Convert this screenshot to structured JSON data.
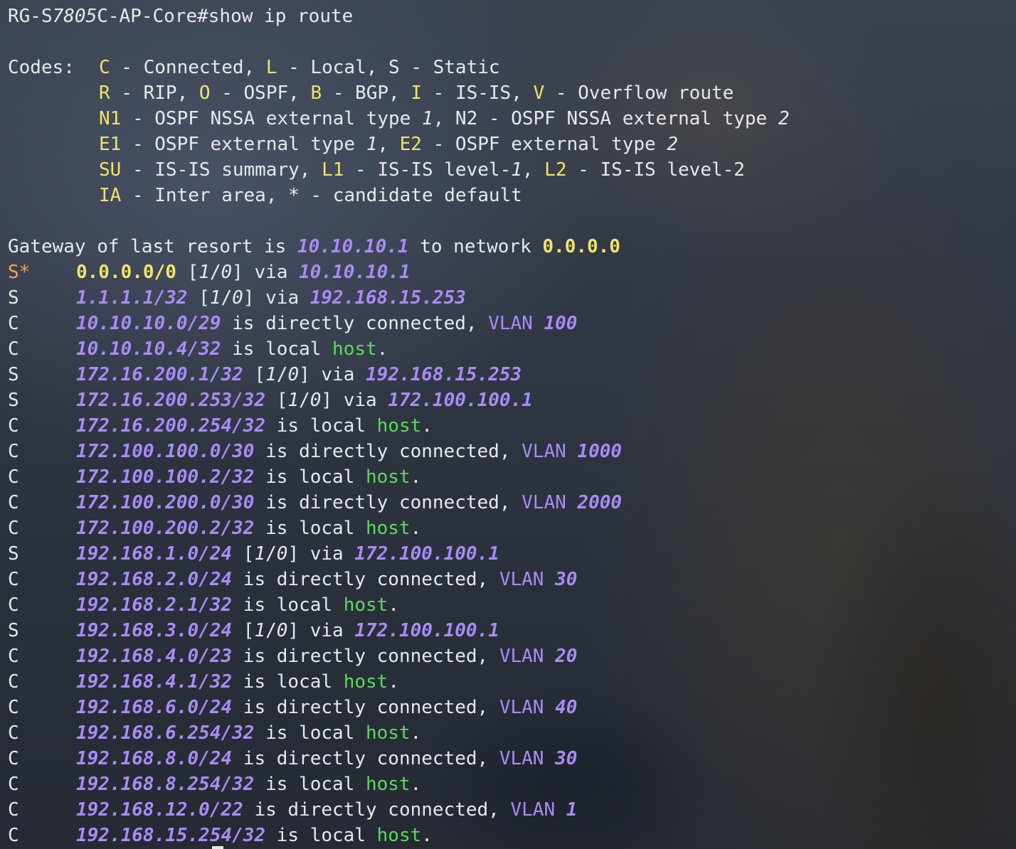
{
  "terminal": {
    "prompt_host": "RG-S",
    "prompt_model": "7805",
    "prompt_rest": "C-AP-Core#show ip route"
  },
  "codes": {
    "label": "Codes:",
    "line1": {
      "c": "C",
      "c_txt": " - Connected, ",
      "l": "L",
      "l_txt": " - Local, S - Static"
    },
    "line2": {
      "r": "R",
      "r_txt": " - RIP, ",
      "o": "O",
      "o_txt": " - OSPF, ",
      "b": "B",
      "b_txt": " - BGP, ",
      "i": "I",
      "i_txt": " - IS-IS, ",
      "v": "V",
      "v_txt": " - Overflow route"
    },
    "line3": {
      "n1": "N1",
      "n1_txt": " - OSPF NSSA external type ",
      "n1_num": "1",
      "n2_txt": ", N2 - OSPF NSSA external type ",
      "n2_num": "2"
    },
    "line4": {
      "e1": "E1",
      "e1_txt": " - OSPF external type ",
      "e1_num": "1",
      "sep": ", ",
      "e2": "E2",
      "e2_txt": " - OSPF external type ",
      "e2_num": "2"
    },
    "line5": {
      "su": "SU",
      "su_txt": " - IS-IS summary, ",
      "l1": "L1",
      "l1_txt": " - IS-IS level-",
      "l1_num": "1",
      "sep": ", ",
      "l2": "L2",
      "l2_txt": " - IS-IS level-2"
    },
    "line6": {
      "ia": "IA",
      "ia_txt": " - Inter area, * - candidate default"
    }
  },
  "gateway": {
    "prefix": "Gateway of last resort is ",
    "ip": "10.10.10.1",
    "mid": " to network ",
    "network": "0.0.0.0"
  },
  "default_route": {
    "flag": "S*",
    "network": "0.0.0.0/0",
    "metric_open": " [",
    "metric_a": "1",
    "metric_sep": "/",
    "metric_b": "0",
    "metric_close": "] via ",
    "via": "10.10.10.1"
  },
  "routes": [
    {
      "flag": "S",
      "network": "1.1.1.1/32",
      "kind": "static",
      "via": "192.168.15.253"
    },
    {
      "flag": "C",
      "network": "10.10.10.0/29",
      "kind": "connected",
      "vlan": "100"
    },
    {
      "flag": "C",
      "network": "10.10.10.4/32",
      "kind": "local"
    },
    {
      "flag": "S",
      "network": "172.16.200.1/32",
      "kind": "static",
      "via": "192.168.15.253"
    },
    {
      "flag": "S",
      "network": "172.16.200.253/32",
      "kind": "static",
      "via": "172.100.100.1"
    },
    {
      "flag": "C",
      "network": "172.16.200.254/32",
      "kind": "local"
    },
    {
      "flag": "C",
      "network": "172.100.100.0/30",
      "kind": "connected",
      "vlan": "1000"
    },
    {
      "flag": "C",
      "network": "172.100.100.2/32",
      "kind": "local"
    },
    {
      "flag": "C",
      "network": "172.100.200.0/30",
      "kind": "connected",
      "vlan": "2000"
    },
    {
      "flag": "C",
      "network": "172.100.200.2/32",
      "kind": "local"
    },
    {
      "flag": "S",
      "network": "192.168.1.0/24",
      "kind": "static",
      "via": "172.100.100.1"
    },
    {
      "flag": "C",
      "network": "192.168.2.0/24",
      "kind": "connected",
      "vlan": "30"
    },
    {
      "flag": "C",
      "network": "192.168.2.1/32",
      "kind": "local"
    },
    {
      "flag": "S",
      "network": "192.168.3.0/24",
      "kind": "static",
      "via": "172.100.100.1"
    },
    {
      "flag": "C",
      "network": "192.168.4.0/23",
      "kind": "connected",
      "vlan": "20"
    },
    {
      "flag": "C",
      "network": "192.168.4.1/32",
      "kind": "local"
    },
    {
      "flag": "C",
      "network": "192.168.6.0/24",
      "kind": "connected",
      "vlan": "40"
    },
    {
      "flag": "C",
      "network": "192.168.6.254/32",
      "kind": "local"
    },
    {
      "flag": "C",
      "network": "192.168.8.0/24",
      "kind": "connected",
      "vlan": "30"
    },
    {
      "flag": "C",
      "network": "192.168.8.254/32",
      "kind": "local"
    },
    {
      "flag": "C",
      "network": "192.168.12.0/22",
      "kind": "connected",
      "vlan": "1"
    },
    {
      "flag": "C",
      "network": "192.168.15.254/32",
      "kind": "local"
    }
  ],
  "phrases": {
    "static_mid_open": " [",
    "static_a": "1",
    "static_sep": "/",
    "static_b": "0",
    "static_mid_close": "] via ",
    "connected": " is directly connected, ",
    "vlan_word": "VLAN ",
    "local": " is local ",
    "host": "host",
    "period": "."
  },
  "colors": {
    "keyword_yellow": "#f0e46a",
    "ip_purple": "#a98bf5",
    "host_green": "#5cdb5c",
    "default_orange": "#f2a54a"
  }
}
